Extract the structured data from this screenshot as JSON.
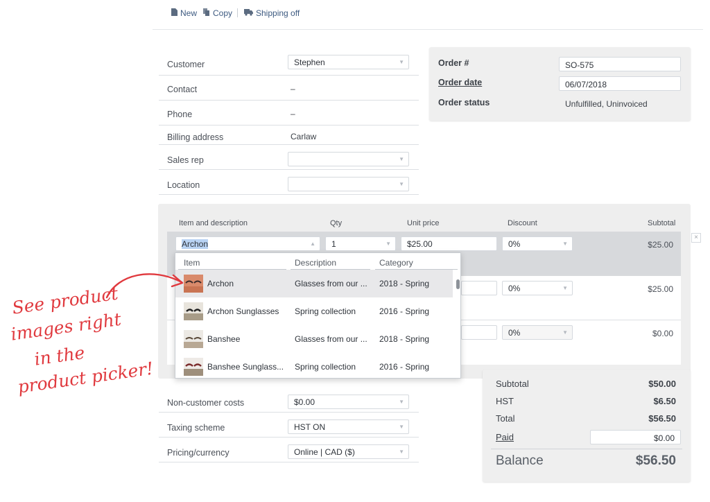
{
  "toolbar": {
    "new_label": "New",
    "copy_label": "Copy",
    "shipping_label": "Shipping off"
  },
  "form": {
    "customer": {
      "label": "Customer",
      "value": "Stephen"
    },
    "contact": {
      "label": "Contact",
      "value": "–"
    },
    "phone": {
      "label": "Phone",
      "value": "–"
    },
    "billing": {
      "label": "Billing address",
      "value": "Carlaw"
    },
    "sales_rep": {
      "label": "Sales rep",
      "value": ""
    },
    "location": {
      "label": "Location",
      "value": ""
    }
  },
  "order": {
    "number_label": "Order #",
    "number_value": "SO-575",
    "date_label": "Order date",
    "date_value": "06/07/2018",
    "status_label": "Order status",
    "status_value": "Unfulfilled, Uninvoiced"
  },
  "items": {
    "headers": {
      "item": "Item and description",
      "qty": "Qty",
      "unit_price": "Unit price",
      "discount": "Discount",
      "subtotal": "Subtotal"
    },
    "rows": [
      {
        "item": "Archon",
        "qty": "1",
        "unit_price": "$25.00",
        "discount": "0%",
        "subtotal": "$25.00"
      },
      {
        "discount": "0%",
        "subtotal": "$25.00"
      },
      {
        "discount": "0%",
        "subtotal": "$0.00"
      }
    ],
    "remove_glyph": "×"
  },
  "picker": {
    "headers": {
      "item": "Item",
      "description": "Description",
      "category": "Category"
    },
    "rows": [
      {
        "name": "Archon",
        "description": "Glasses from our ...",
        "category": "2018 - Spring",
        "selected": true
      },
      {
        "name": "Archon Sunglasses",
        "description": "Spring collection",
        "category": "2016 - Spring",
        "selected": false
      },
      {
        "name": "Banshee",
        "description": "Glasses from our ...",
        "category": "2018 - Spring",
        "selected": false
      },
      {
        "name": "Banshee Sunglass...",
        "description": "Spring collection",
        "category": "2016 - Spring",
        "selected": false
      }
    ]
  },
  "bottom_form": {
    "non_customer_costs": {
      "label": "Non-customer costs",
      "value": "$0.00"
    },
    "taxing_scheme": {
      "label": "Taxing scheme",
      "value": "HST ON"
    },
    "pricing_currency": {
      "label": "Pricing/currency",
      "value": "Online | CAD ($)"
    }
  },
  "totals": {
    "subtotal_label": "Subtotal",
    "subtotal_value": "$50.00",
    "hst_label": "HST",
    "hst_value": "$6.50",
    "total_label": "Total",
    "total_value": "$56.50",
    "paid_label": "Paid",
    "paid_value": "$0.00",
    "balance_label": "Balance",
    "balance_value": "$56.50"
  },
  "annotation": {
    "line1": "See product",
    "line2": "images right",
    "line3": "in the",
    "line4": "product picker!"
  },
  "colors": {
    "annotation": "#e0393e",
    "highlight": "#b9d3f3",
    "panel": "#efefef"
  }
}
